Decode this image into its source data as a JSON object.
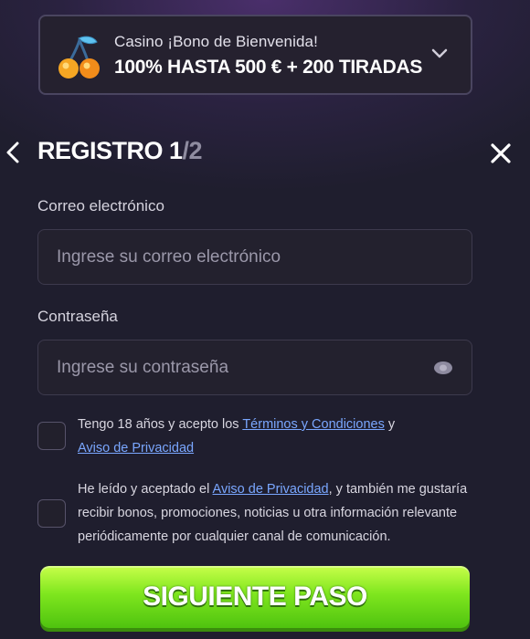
{
  "bonus": {
    "subtitle": "Casino ¡Bono de Bienvenida!",
    "headline": "100% HASTA 500 € + 200 TIRADAS",
    "icon": "cherries-icon",
    "expand_icon": "chevron-down-icon"
  },
  "header": {
    "title_prefix": "REGISTRO 1",
    "title_sep": "/2",
    "back_icon": "chevron-left-icon",
    "close_icon": "close-icon"
  },
  "form": {
    "email": {
      "label": "Correo electrónico",
      "placeholder": "Ingrese su correo electrónico",
      "value": ""
    },
    "password": {
      "label": "Contraseña",
      "placeholder": "Ingrese su contraseña",
      "value": "",
      "toggle_icon": "eye-icon"
    },
    "terms": {
      "text_before": "Tengo 18 años y acepto los ",
      "link1": "Términos y Condiciones",
      "text_mid": " y",
      "link2": "Aviso de Privacidad",
      "checked": false
    },
    "marketing": {
      "text_before": "He leído y aceptado el ",
      "link": "Aviso de Privacidad",
      "text_line1_after": ", y también me gustaría",
      "text_line2": "recibir bonos, promociones, noticias u otra información relevante",
      "text_line3": "periódicamente por cualquier canal de comunicación.",
      "checked": false
    }
  },
  "cta": {
    "label": "SIGUIENTE PASO"
  },
  "colors": {
    "background": "#1f1e2e",
    "accent_green": "#7fe61e",
    "link": "#7aa7ff"
  }
}
